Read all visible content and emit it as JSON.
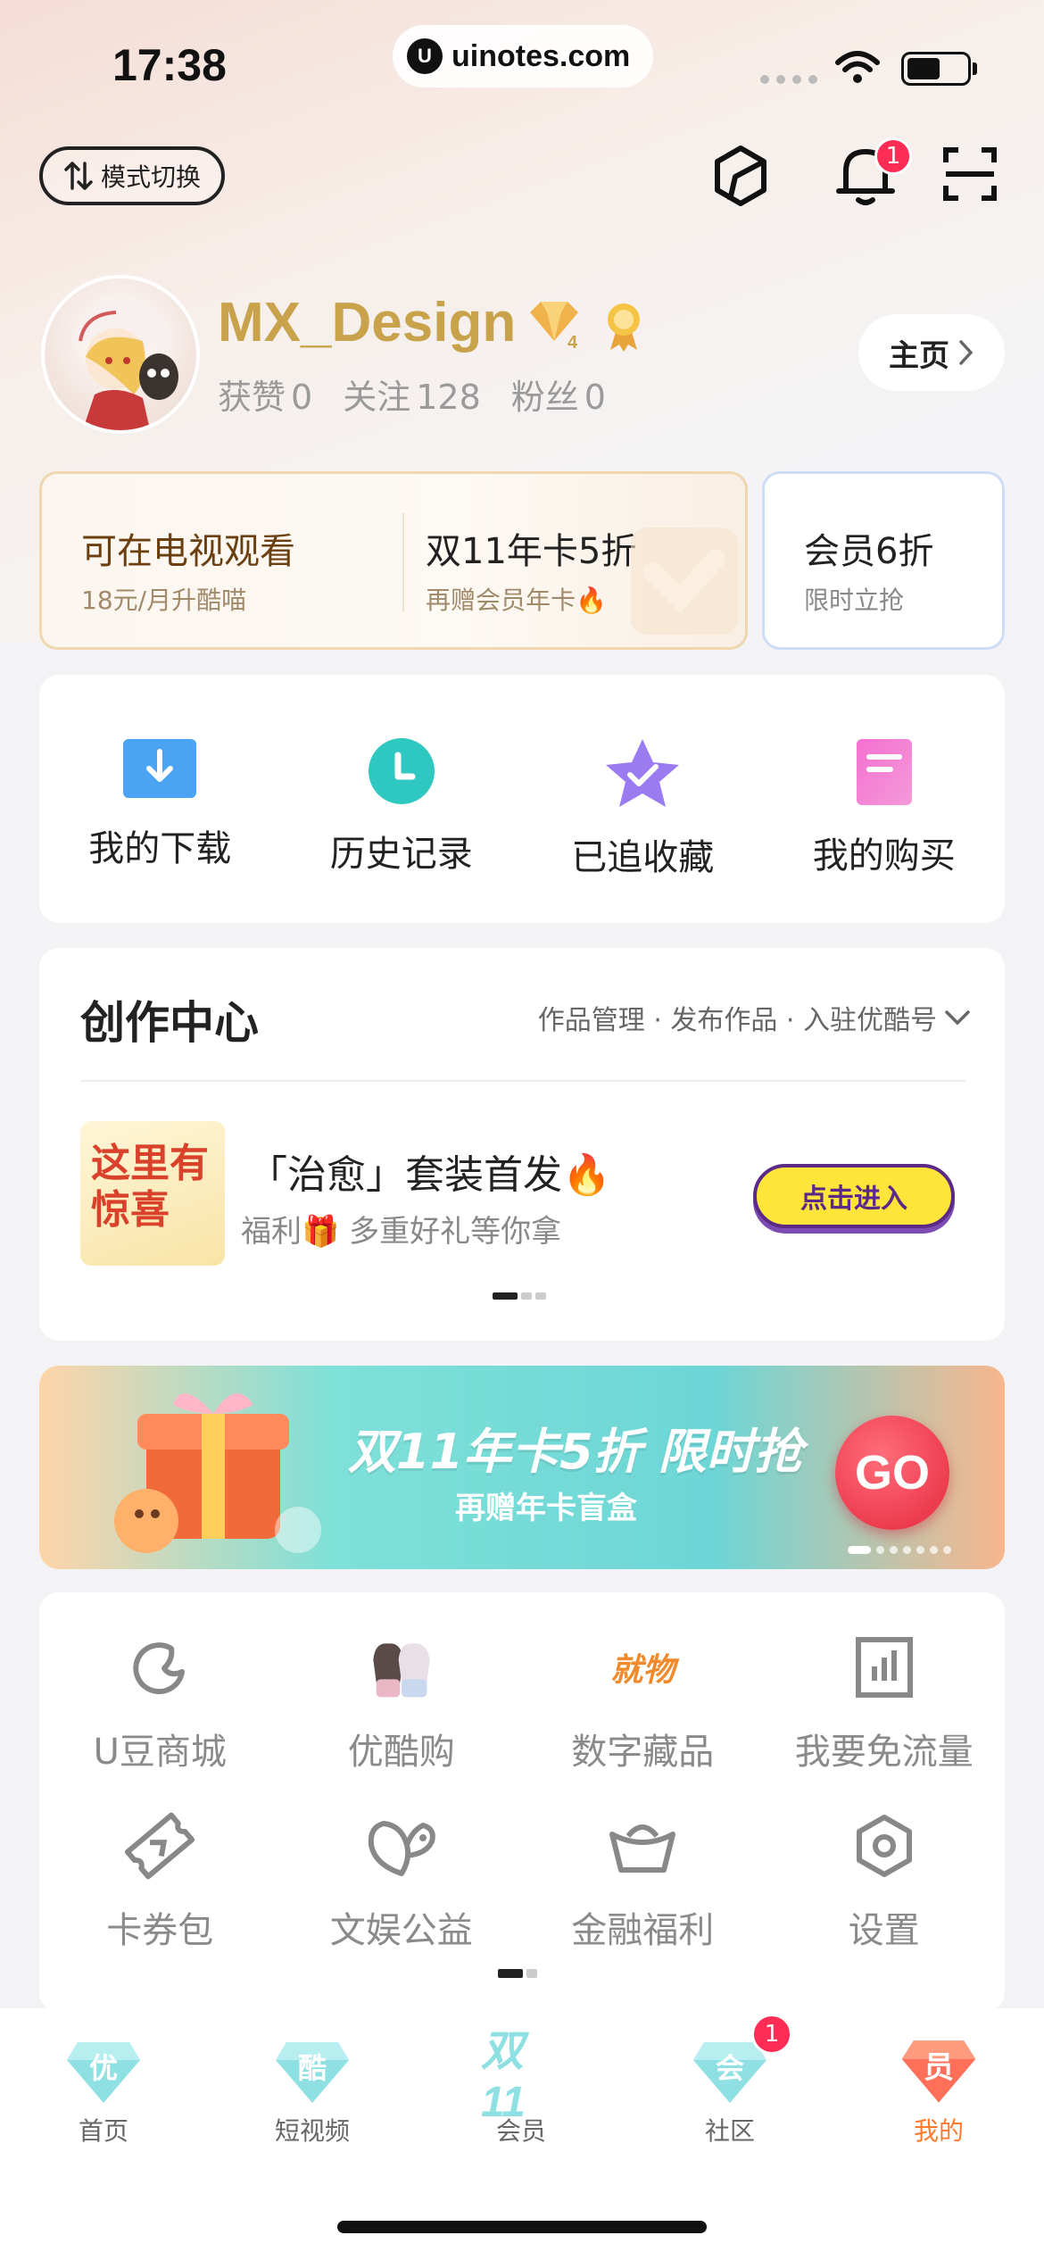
{
  "status_bar": {
    "time": "17:38",
    "url": "uinotes.com",
    "url_logo": "U"
  },
  "header": {
    "mode_switch_label": "模式切换",
    "notification_count": "1"
  },
  "profile": {
    "username": "MX_Design",
    "level": "4",
    "likes_label": "获赞",
    "likes": "0",
    "following_label": "关注",
    "following": "128",
    "fans_label": "粉丝",
    "fans": "0",
    "homepage_button": "主页"
  },
  "vip": {
    "tv_title": "可在电视观看",
    "tv_sub": "18元/月升酷喵",
    "deal_title": "双11年卡5折",
    "deal_sub": "再赠会员年卡🔥",
    "member_title": "会员6折",
    "member_sub": "限时立抢"
  },
  "quick_actions": [
    {
      "label": "我的下载",
      "icon": "download-icon",
      "color": "#4aa3f3"
    },
    {
      "label": "历史记录",
      "icon": "history-clock-icon",
      "color": "#2fc8c0"
    },
    {
      "label": "已追收藏",
      "icon": "favorite-star-icon",
      "color": "#9b7bf0"
    },
    {
      "label": "我的购买",
      "icon": "purchase-doc-icon",
      "color": "#f27ed6"
    }
  ],
  "creator": {
    "title": "创作中心",
    "links": "作品管理 · 发布作品 · 入驻优酷号",
    "promo_thumb_text": "这里有惊喜",
    "promo_title": "「治愈」套装首发🔥",
    "promo_sub": "福利🎁 多重好礼等你拿",
    "promo_button": "点击进入"
  },
  "banner": {
    "title": "双11年卡5折 限时抢",
    "subtitle": "再赠年卡盲盒",
    "go_label": "GO"
  },
  "services": [
    {
      "label": "U豆商城",
      "icon": "u-bean-icon"
    },
    {
      "label": "优酷购",
      "icon": "youku-shop-icon"
    },
    {
      "label": "数字藏品",
      "icon": "digital-collection-icon",
      "icon_text": "就物"
    },
    {
      "label": "我要免流量",
      "icon": "free-data-icon"
    },
    {
      "label": "卡券包",
      "icon": "coupon-icon"
    },
    {
      "label": "文娱公益",
      "icon": "charity-icon"
    },
    {
      "label": "金融福利",
      "icon": "finance-icon"
    },
    {
      "label": "设置",
      "icon": "settings-icon"
    }
  ],
  "tabbar": {
    "items": [
      {
        "label": "首页",
        "icon_text": "优"
      },
      {
        "label": "短视频",
        "icon_text": "酷"
      },
      {
        "label": "会员",
        "icon_text": "双11"
      },
      {
        "label": "社区",
        "icon_text": "会"
      },
      {
        "label": "我的",
        "icon_text": "员"
      }
    ],
    "community_badge": "1",
    "active_color": "#ff7a2f"
  }
}
